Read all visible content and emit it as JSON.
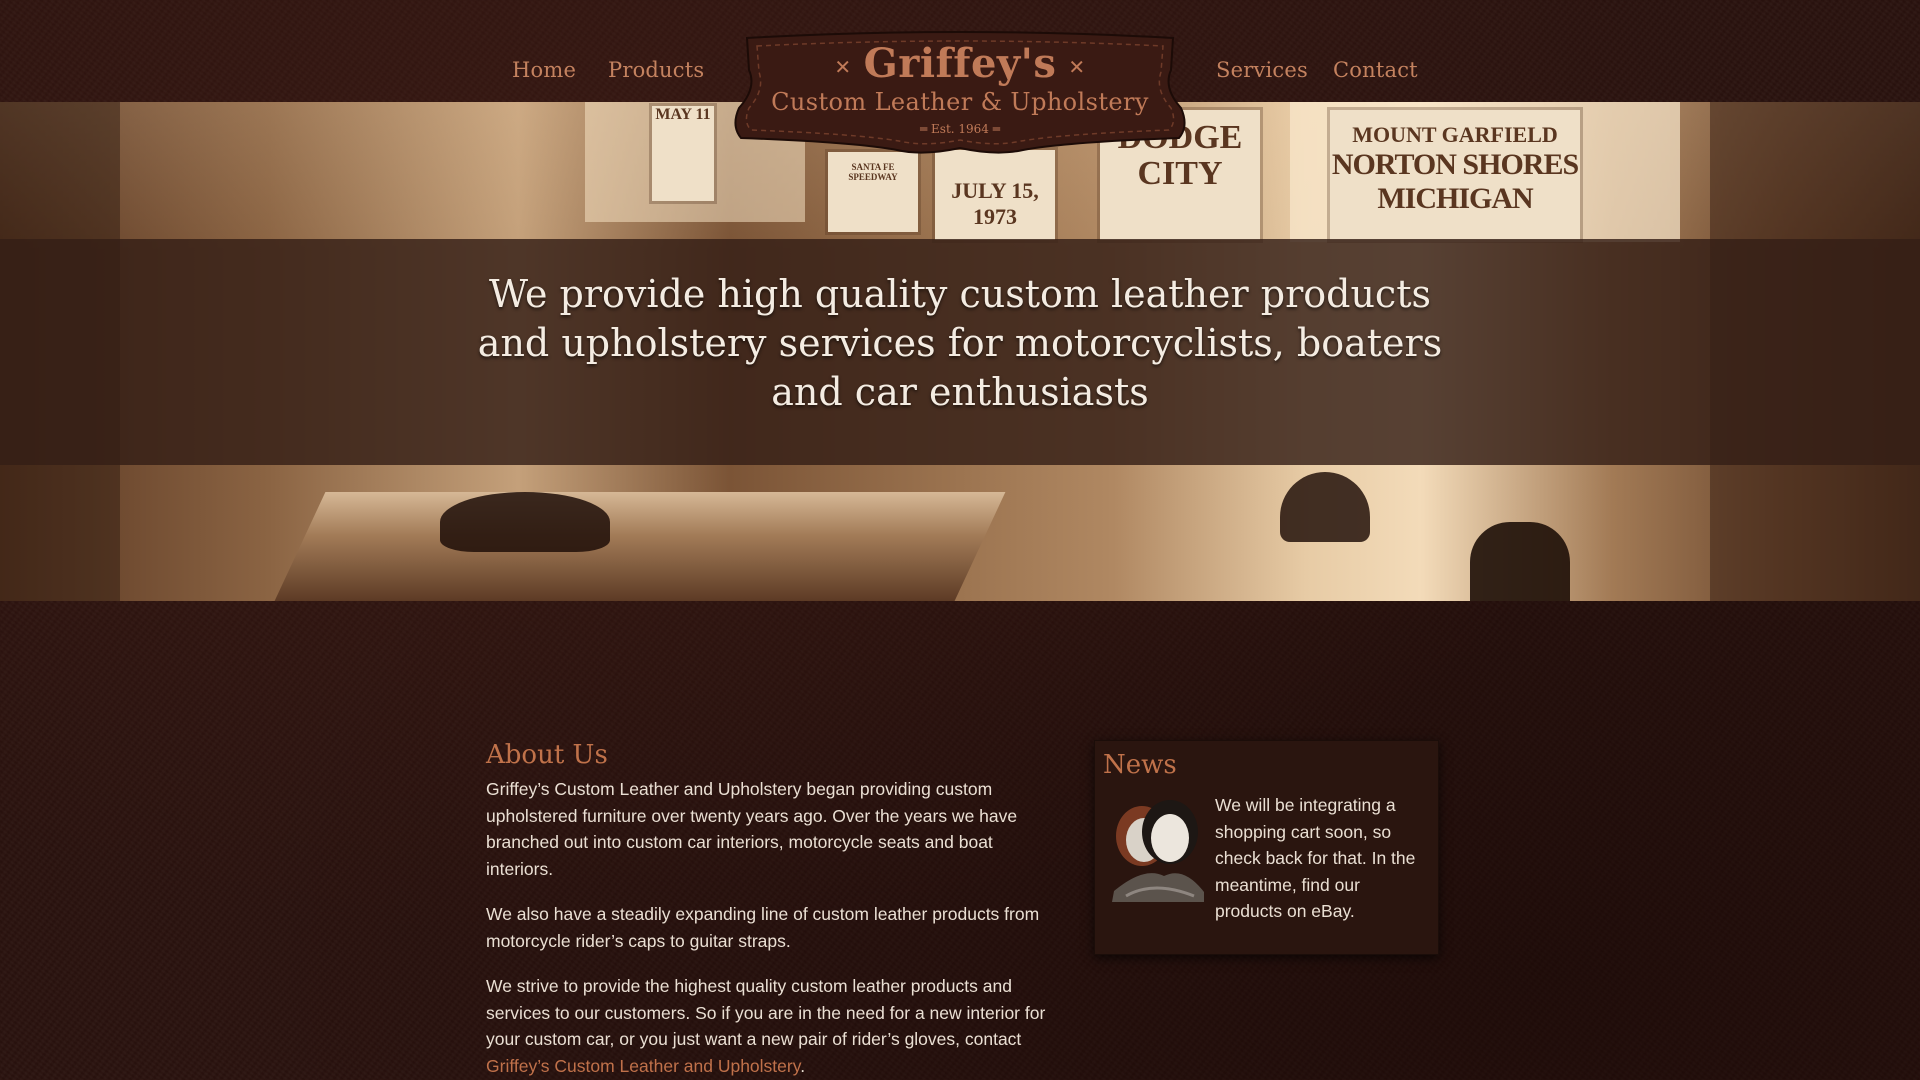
{
  "nav": {
    "home": "Home",
    "products": "Products",
    "services": "Services",
    "contact": "Contact"
  },
  "logo": {
    "name": "Griffey's",
    "subtitle": "Custom Leather & Upholstery",
    "est": "Est. 1964"
  },
  "hero": {
    "tagline_line1": "We provide high quality custom leather products",
    "tagline_line2": "and upholstery services for motorcyclists, boaters",
    "tagline_line3": "and car enthusiasts",
    "poster_left_date": "MAY 11",
    "poster_mid_title": "SANTA FE SPEEDWAY",
    "poster_mid_date": "JULY 15, 1973",
    "poster_city": "DODGE CITY",
    "poster_right_line1": "MOUNT GARFIELD",
    "poster_right_line2": "NORTON SHORES MICHIGAN"
  },
  "about": {
    "title": "About Us",
    "p1": "Griffey’s Custom Leather and Upholstery began providing custom upholstered furniture over twenty years ago. Over the years we have branched out into custom car interiors, motorcycle seats and boat interiors.",
    "p2": "We also have a steadily expanding line of custom leather products from motorcycle rider’s caps to guitar straps.",
    "p3_text": "We strive to provide the highest quality custom leather products and services to our customers. So if you are in the need for a new interior for your custom car, or you just want a new pair of rider’s gloves, contact ",
    "p3_link": "Griffey’s Custom Leather and Upholstery",
    "p3_end": "."
  },
  "news": {
    "title": "News",
    "text": "We will be integrating a shopping cart soon, so check back for that. In the meantime, find our products on eBay."
  },
  "colors": {
    "background": "#2b130f",
    "accent": "#c0724a",
    "nav": "#c4825f",
    "text": "#eadfd3"
  }
}
